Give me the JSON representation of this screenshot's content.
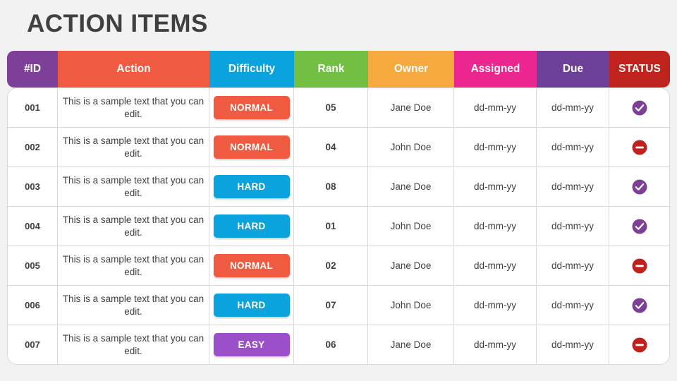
{
  "title": "ACTION ITEMS",
  "table": {
    "headers": [
      {
        "key": "id",
        "label": "#ID",
        "color": "#7d3f98"
      },
      {
        "key": "action",
        "label": "Action",
        "color": "#f05a41"
      },
      {
        "key": "difficulty",
        "label": "Difficulty",
        "color": "#0aa3dd"
      },
      {
        "key": "rank",
        "label": "Rank",
        "color": "#72bf44"
      },
      {
        "key": "owner",
        "label": "Owner",
        "color": "#f5a93f"
      },
      {
        "key": "assigned",
        "label": "Assigned",
        "color": "#ec268f"
      },
      {
        "key": "due",
        "label": "Due",
        "color": "#6c3f99"
      },
      {
        "key": "status",
        "label": "STATUS",
        "color": "#c0231e"
      }
    ],
    "rows": [
      {
        "id": "001",
        "action": "This is a sample text that you can edit.",
        "difficulty": "NORMAL",
        "difficulty_color": "#f05a41",
        "rank": "05",
        "owner": "Jane Doe",
        "assigned": "dd-mm-yy",
        "due": "dd-mm-yy",
        "status": "check-circle-icon",
        "status_color": "#7d3f98"
      },
      {
        "id": "002",
        "action": "This is a sample text that you can edit.",
        "difficulty": "NORMAL",
        "difficulty_color": "#f05a41",
        "rank": "04",
        "owner": "John Doe",
        "assigned": "dd-mm-yy",
        "due": "dd-mm-yy",
        "status": "minus-circle-icon",
        "status_color": "#c0231e"
      },
      {
        "id": "003",
        "action": "This is a sample text that you can edit.",
        "difficulty": "HARD",
        "difficulty_color": "#0aa3dd",
        "rank": "08",
        "owner": "Jane Doe",
        "assigned": "dd-mm-yy",
        "due": "dd-mm-yy",
        "status": "check-circle-icon",
        "status_color": "#7d3f98"
      },
      {
        "id": "004",
        "action": "This is a sample text that you can edit.",
        "difficulty": "HARD",
        "difficulty_color": "#0aa3dd",
        "rank": "01",
        "owner": "John Doe",
        "assigned": "dd-mm-yy",
        "due": "dd-mm-yy",
        "status": "check-circle-icon",
        "status_color": "#7d3f98"
      },
      {
        "id": "005",
        "action": "This is a sample text that you can edit.",
        "difficulty": "NORMAL",
        "difficulty_color": "#f05a41",
        "rank": "02",
        "owner": "Jane Doe",
        "assigned": "dd-mm-yy",
        "due": "dd-mm-yy",
        "status": "minus-circle-icon",
        "status_color": "#c0231e"
      },
      {
        "id": "006",
        "action": "This is a sample text that you can edit.",
        "difficulty": "HARD",
        "difficulty_color": "#0aa3dd",
        "rank": "07",
        "owner": "John Doe",
        "assigned": "dd-mm-yy",
        "due": "dd-mm-yy",
        "status": "check-circle-icon",
        "status_color": "#7d3f98"
      },
      {
        "id": "007",
        "action": "This is a sample text that you can edit.",
        "difficulty": "EASY",
        "difficulty_color": "#9b4fc8",
        "rank": "06",
        "owner": "Jane Doe",
        "assigned": "dd-mm-yy",
        "due": "dd-mm-yy",
        "status": "minus-circle-icon",
        "status_color": "#c0231e"
      }
    ]
  }
}
